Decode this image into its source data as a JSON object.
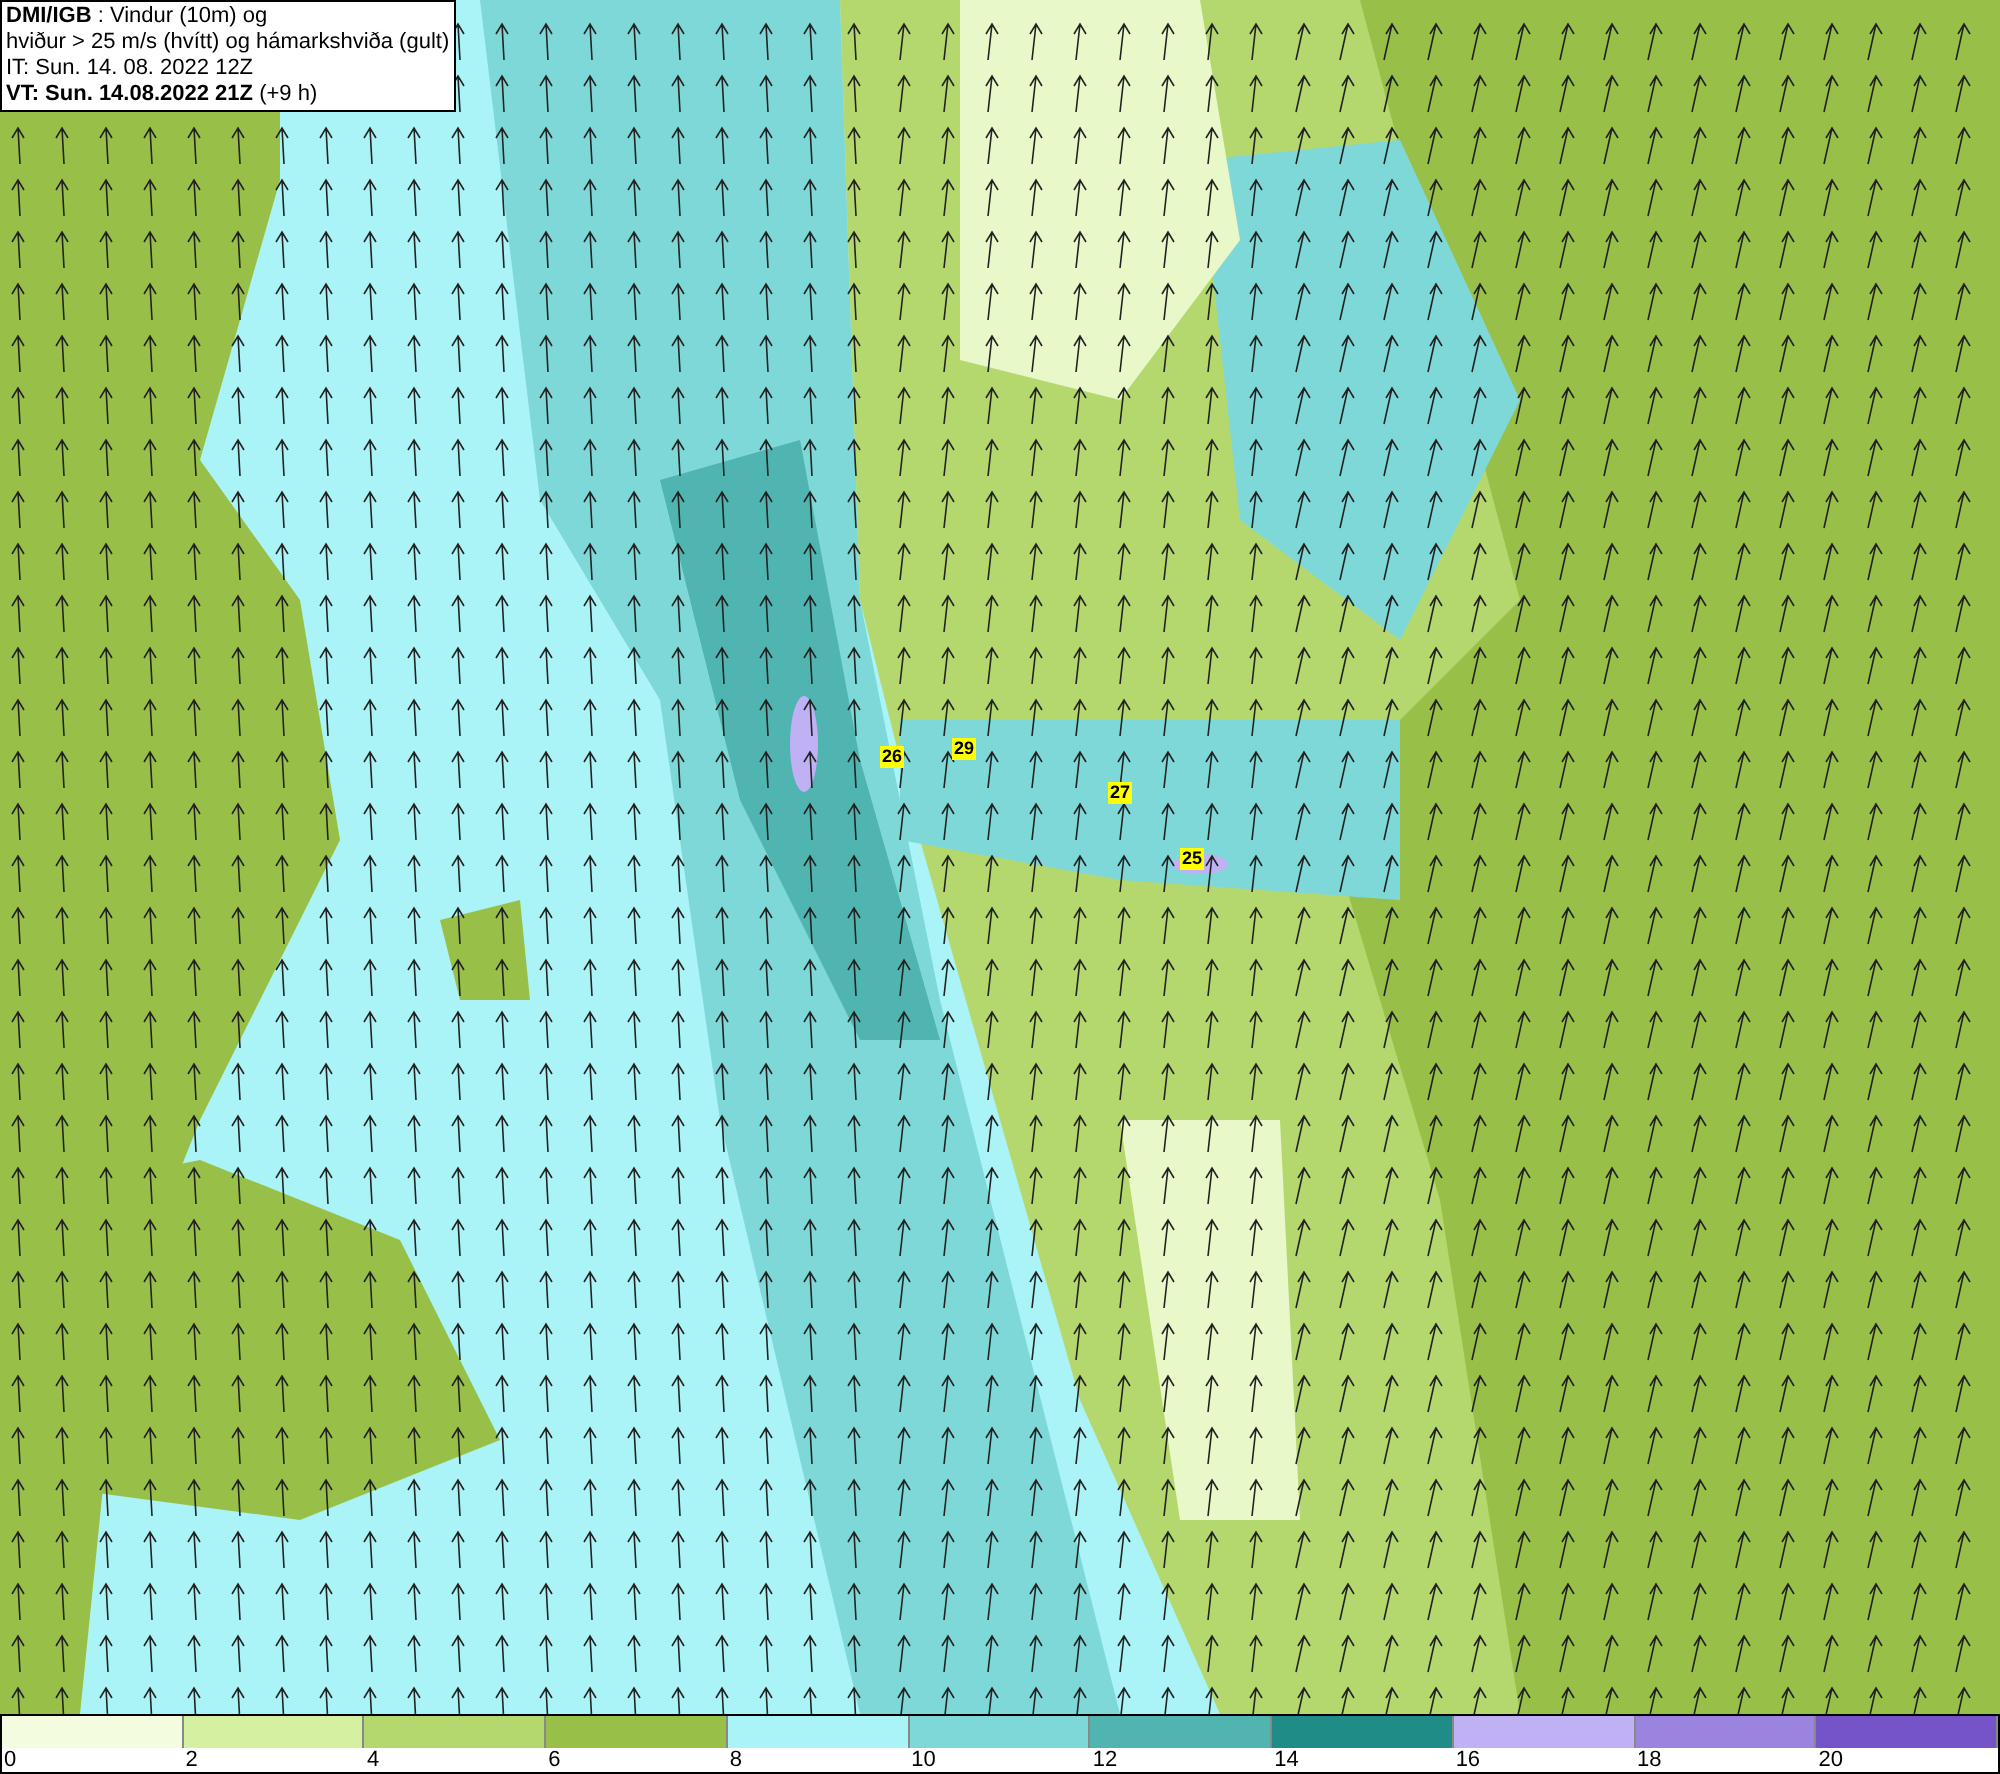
{
  "title_box": {
    "lines": [
      "**DMI/IGB** : Vindur (10m) og",
      "hviður > 25 m/s (hvítt) og hámarkshviða (gult)",
      "IT: Sun. 14. 08. 2022 12Z",
      "**VT: Sun. 14.08.2022 21Z** (+9 h)"
    ]
  },
  "map": {
    "gust_labels": [
      "26",
      "29",
      "27",
      "25"
    ]
  },
  "legend": {
    "bins": [
      {
        "color": "#f4fce0"
      },
      {
        "color": "#d4f0a0"
      },
      {
        "color": "#b4d86e"
      },
      {
        "color": "#98c048"
      },
      {
        "color": "#aaf4f8"
      },
      {
        "color": "#7fd8d8"
      },
      {
        "color": "#50b4b0"
      },
      {
        "color": "#208c88"
      },
      {
        "color": "#c0b0f4"
      },
      {
        "color": "#9a84e0"
      },
      {
        "color": "#7454c8"
      }
    ],
    "ticks": [
      "0",
      "2",
      "4",
      "6",
      "8",
      "10",
      "12",
      "14",
      "16",
      "18",
      "20"
    ]
  }
}
